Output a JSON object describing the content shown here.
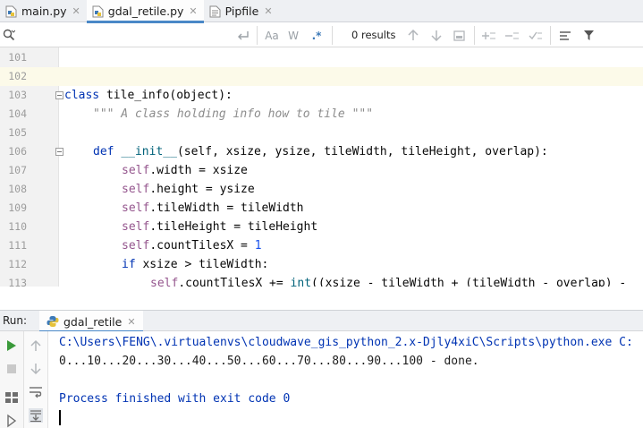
{
  "tabs": [
    {
      "label": "main.py",
      "icon": "python-file-icon",
      "active": false
    },
    {
      "label": "gdal_retile.py",
      "icon": "python-file-icon",
      "active": true
    },
    {
      "label": "Pipfile",
      "icon": "pipfile-icon",
      "active": false
    }
  ],
  "search": {
    "placeholder": "",
    "value": "",
    "match_case_label": "Aa",
    "words_label": "W",
    "regex_label": ".*",
    "results_text": "0 results"
  },
  "editor": {
    "current_line": "102",
    "lines": [
      {
        "num": "101"
      },
      {
        "num": "102"
      },
      {
        "num": "103"
      },
      {
        "num": "104"
      },
      {
        "num": "105"
      },
      {
        "num": "106"
      },
      {
        "num": "107"
      },
      {
        "num": "108"
      },
      {
        "num": "109"
      },
      {
        "num": "110"
      },
      {
        "num": "111"
      },
      {
        "num": "112"
      },
      {
        "num": "113"
      }
    ],
    "code": {
      "l103_kw": "class",
      "l103_rest": " tile_info(object):",
      "l104_doc": "\"\"\" A class holding info how to tile \"\"\"",
      "l106_kw": "def",
      "l106_fn": "__init__",
      "l106_rest": "(self, xsize, ysize, tileWidth, tileHeight, overlap):",
      "l107_self": "self",
      "l107_rest": ".width = xsize",
      "l108_self": "self",
      "l108_rest": ".height = ysize",
      "l109_self": "self",
      "l109_rest": ".tileWidth = tileWidth",
      "l110_self": "self",
      "l110_rest": ".tileHeight = tileHeight",
      "l111_self": "self",
      "l111_rest": ".countTilesX = ",
      "l111_num": "1",
      "l112_kw": "if",
      "l112_rest": " xsize > tileWidth:",
      "l113_self": "self",
      "l113_rest": ".countTilesX += ",
      "l113_fn": "int",
      "l113_tail": "((xsize - tileWidth + (tileWidth - overlap) -"
    }
  },
  "run": {
    "label": "Run:",
    "tab_label": "gdal_retile",
    "console": [
      {
        "kind": "cmd",
        "text": "C:\\Users\\FENG\\.virtualenvs\\cloudwave_gis_python_2.x-Djly4xiC\\Scripts\\python.exe C:"
      },
      {
        "kind": "out",
        "text": "0...10...20...30...40...50...60...70...80...90...100 - done."
      },
      {
        "kind": "blank",
        "text": ""
      },
      {
        "kind": "exit",
        "text": "Process finished with exit code 0"
      }
    ]
  },
  "colors": {
    "accent": "#4a88c7",
    "keyword": "#0033b3",
    "self": "#94558d",
    "number": "#1750eb",
    "run_green": "#3a9a3a"
  }
}
